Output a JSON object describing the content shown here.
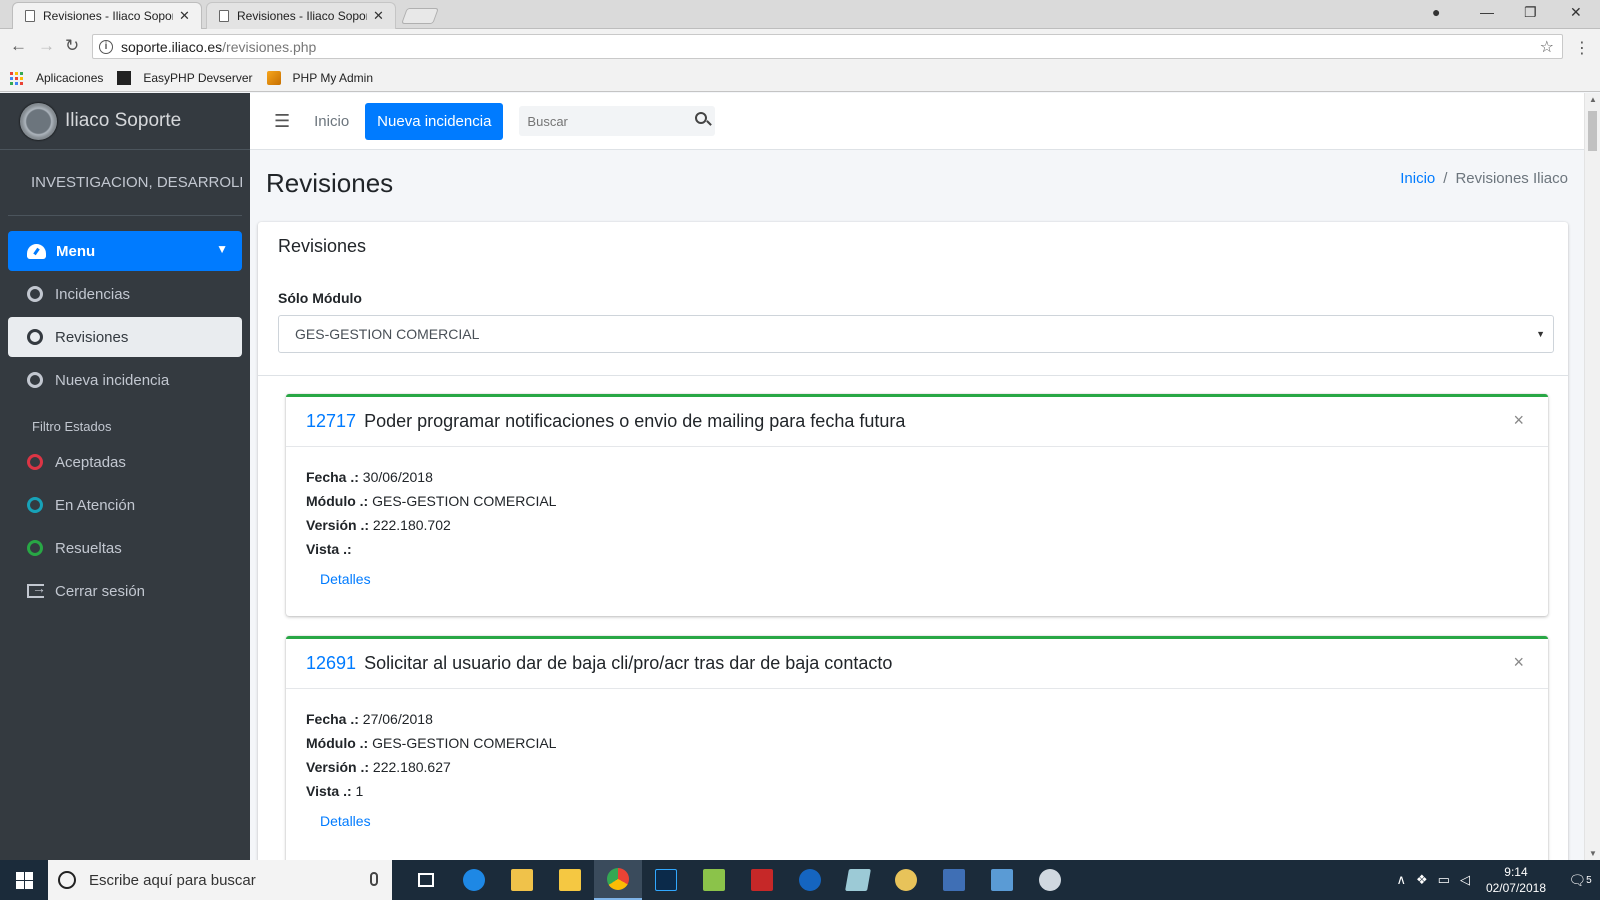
{
  "browser": {
    "tabs": [
      {
        "title": "Revisiones - Iliaco Soporte",
        "close": "✕"
      },
      {
        "title": "Revisiones - Iliaco Soporte",
        "close": "✕"
      }
    ],
    "url_host": "soporte.iliaco.es",
    "url_path": "/revisiones.php",
    "bookmarks": [
      {
        "label": "Aplicaciones",
        "icon": "apps-grid-icon"
      },
      {
        "label": "EasyPHP Devserver",
        "icon": "easyphp-icon"
      },
      {
        "label": "PHP My Admin",
        "icon": "phpmyadmin-icon"
      }
    ]
  },
  "sidebar": {
    "brand": "Iliaco Soporte",
    "user": "INVESTIGACION, DESARROLLO Y",
    "menu_label": "Menu",
    "items": [
      {
        "label": "Incidencias"
      },
      {
        "label": "Revisiones",
        "active": true
      },
      {
        "label": "Nueva incidencia"
      }
    ],
    "filter_header": "Filtro Estados",
    "filters": [
      {
        "label": "Aceptadas",
        "color": "#dc3545"
      },
      {
        "label": "En Atención",
        "color": "#17a2b8"
      },
      {
        "label": "Resueltas",
        "color": "#28a745"
      }
    ],
    "logout": "Cerrar sesión"
  },
  "topnav": {
    "home": "Inicio",
    "new_button": "Nueva incidencia",
    "search_placeholder": "Buscar"
  },
  "page": {
    "title": "Revisiones",
    "breadcrumb_home": "Inicio",
    "breadcrumb_sep": "/",
    "breadcrumb_current": "Revisiones Iliaco"
  },
  "main_card": {
    "header": "Revisiones",
    "module_label": "Sólo Módulo",
    "module_selected": "GES-GESTION COMERCIAL"
  },
  "labels": {
    "fecha": "Fecha .:",
    "modulo": "Módulo .:",
    "version": "Versión .:",
    "vista": "Vista .:",
    "detalles": "Detalles",
    "close": "×"
  },
  "revisions": [
    {
      "id": "12717",
      "title": "Poder programar notificaciones o envio de mailing para fecha futura",
      "fecha": "30/06/2018",
      "modulo": "GES-GESTION COMERCIAL",
      "version": "222.180.702",
      "vista": ""
    },
    {
      "id": "12691",
      "title": "Solicitar al usuario dar de baja cli/pro/acr tras dar de baja contacto",
      "fecha": "27/06/2018",
      "modulo": "GES-GESTION COMERCIAL",
      "version": "222.180.627",
      "vista": "1"
    }
  ],
  "taskbar": {
    "search_placeholder": "Escribe aquí para buscar",
    "time": "9:14",
    "date": "02/07/2018",
    "notifications": "5"
  },
  "colors": {
    "accent": "#007bff",
    "sidebar_bg": "#343a40",
    "card_border": "#28a745"
  }
}
